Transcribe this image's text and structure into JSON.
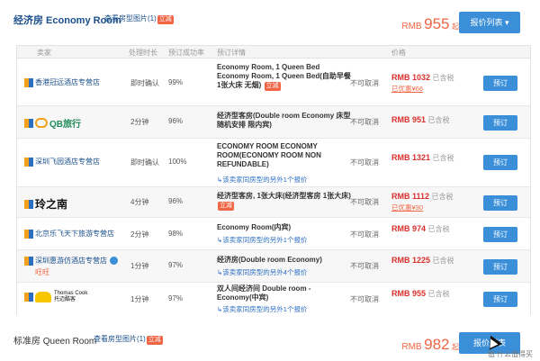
{
  "economy": {
    "title": "经济房 Economy Room",
    "photos_label": "查看房型图片(1)",
    "photos_badge": "立减",
    "price_currency": "RMB",
    "price_value": "955",
    "price_suffix": "起",
    "list_button": "报价列表 ▾"
  },
  "table_headers": {
    "vendor": "卖家",
    "confirm_time": "处理时长",
    "success_rate": "预订成功率",
    "detail": "预订详情",
    "cancel": "",
    "price": "价格"
  },
  "rows": [
    {
      "vendor": "香港冠远酒店专营店",
      "time": "即时确认",
      "rate": "99%",
      "detail": "Economy Room, 1 Queen Bed Economy Room, 1 Queen Bed(自助早餐 1张大床 无烟)",
      "detail_badge": "立减",
      "detail_sub": "",
      "cancel": "不可取消",
      "price": "RMB 1032",
      "tax": "已含税",
      "discount": "已优惠¥66",
      "book": "预订"
    },
    {
      "vendor": "QB旅行",
      "time": "2分钟",
      "rate": "96%",
      "detail": "经济型客房(Double room Economy 床型随机安排 限内宾)",
      "detail_badge": "",
      "detail_sub": "",
      "cancel": "不可取消",
      "price": "RMB 951",
      "tax": "已含税",
      "discount": "",
      "book": "预订"
    },
    {
      "vendor": "深圳飞园酒店专营店",
      "time": "即时确认",
      "rate": "100%",
      "detail": "ECONOMY ROOM ECONOMY ROOM(ECONOMY ROOM NON REFUNDABLE)",
      "detail_badge": "",
      "detail_sub": "↳该卖家同房型的另外1个报价",
      "cancel": "不可取消",
      "price": "RMB 1321",
      "tax": "已含税",
      "discount": "",
      "book": "预订"
    },
    {
      "vendor": "玲之南",
      "time": "4分钟",
      "rate": "96%",
      "detail": "经济型客房, 1张大床(经济型客房 1张大床)",
      "detail_badge": "立减",
      "detail_sub": "",
      "cancel": "不可取消",
      "price": "RMB 1112",
      "tax": "已含税",
      "discount": "已优惠¥30",
      "book": "预订"
    },
    {
      "vendor": "北京乐飞天下旅游专营店",
      "time": "2分钟",
      "rate": "98%",
      "detail": "Economy Room(内宾)",
      "detail_badge": "",
      "detail_sub": "↳该卖家同房型的另外1个报价",
      "cancel": "不可取消",
      "price": "RMB 974",
      "tax": "已含税",
      "discount": "",
      "book": "预订"
    },
    {
      "vendor": "深圳惠游仿酒店专营店",
      "vendor_sub": "旺旺",
      "time": "1分钟",
      "rate": "97%",
      "detail": "经济房(Double room Economy)",
      "detail_badge": "",
      "detail_sub": "↳该卖家同房型的另外4个报价",
      "cancel": "不可取消",
      "price": "RMB 1225",
      "tax": "已含税",
      "discount": "",
      "book": "预订"
    },
    {
      "vendor": "Thomas Cook 托迈酷客",
      "time": "1分钟",
      "rate": "97%",
      "detail": "双人间经济间 Double room - Economy(中宾)",
      "detail_badge": "",
      "detail_sub": "↳该卖家同房型的另外1个报价",
      "cancel": "不可取消",
      "price": "RMB 955",
      "tax": "已含税",
      "discount": "",
      "book": "预订"
    }
  ],
  "queen": {
    "title": "标准房 Queen Room",
    "photos_label": "查看房型图片(1)",
    "photos_badge": "立减",
    "price_currency": "RMB",
    "price_value": "982",
    "price_suffix": "起",
    "list_button": "报价列表"
  },
  "watermark": "值 什么值得买"
}
